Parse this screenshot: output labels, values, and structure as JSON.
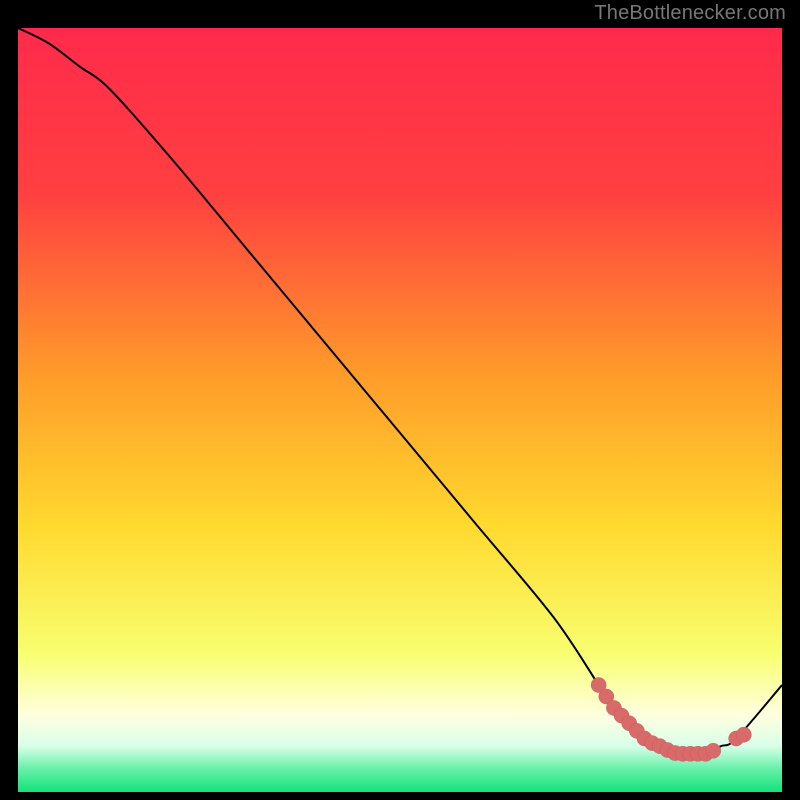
{
  "attribution": "TheBottlenecker.com",
  "colors": {
    "gradient_top": "#ff2a4b",
    "gradient_mid_upper": "#ff7a2f",
    "gradient_mid": "#ffd92e",
    "gradient_lower": "#f6ff7a",
    "gradient_pale": "#ffffe0",
    "gradient_green": "#13e27b",
    "curve": "#000000",
    "marker_fill": "#d86a6a",
    "marker_stroke": "#b24f4f",
    "background": "#000000"
  },
  "chart_data": {
    "type": "line",
    "title": "",
    "xlabel": "",
    "ylabel": "",
    "xlim": [
      0,
      100
    ],
    "ylim": [
      0,
      100
    ],
    "series": [
      {
        "name": "bottleneck-curve",
        "x": [
          0,
          4,
          8,
          12,
          20,
          30,
          40,
          50,
          60,
          70,
          76,
          78,
          80,
          82,
          84,
          86,
          88,
          90,
          92,
          94,
          100
        ],
        "y": [
          100,
          98,
          95,
          92,
          83,
          71,
          59,
          47,
          35,
          23,
          14,
          11,
          9,
          7,
          6,
          5,
          5,
          5,
          6,
          7,
          14
        ]
      }
    ],
    "markers": {
      "name": "highlight-points",
      "x": [
        76,
        77,
        78,
        79,
        80,
        81,
        82,
        83,
        84,
        85,
        86,
        87,
        88,
        89,
        90,
        91,
        94,
        95
      ],
      "y": [
        14,
        12.5,
        11,
        10,
        9,
        8,
        7,
        6.4,
        6,
        5.5,
        5.1,
        5,
        5,
        5,
        5,
        5.4,
        7,
        7.5
      ]
    }
  }
}
